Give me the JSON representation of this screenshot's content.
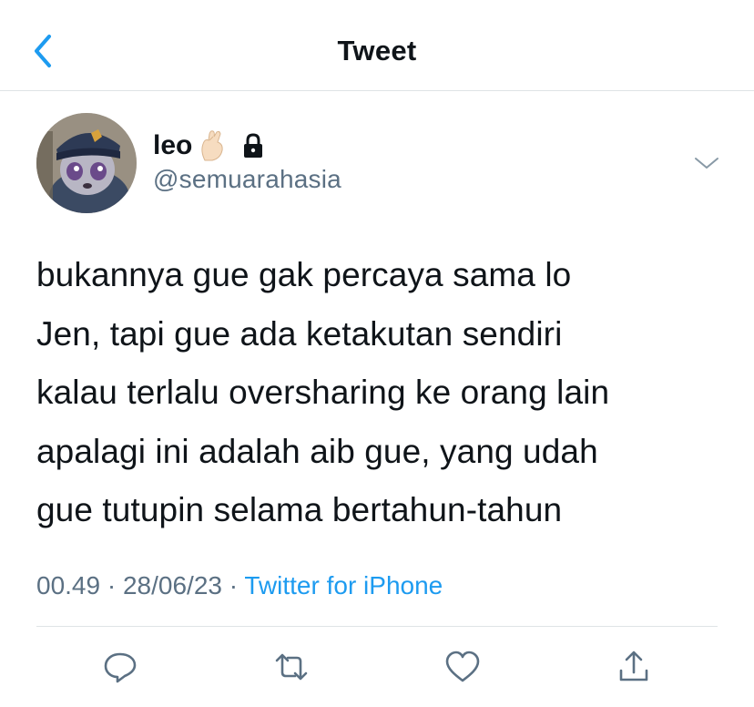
{
  "header": {
    "title": "Tweet",
    "back_icon": "chevron-left-icon"
  },
  "author": {
    "display_name": "leo",
    "handle": "@semuarahasia",
    "badges": [
      "pinched-fingers-icon",
      "lock-icon"
    ]
  },
  "tweet": {
    "lines": [
      "bukannya gue gak percaya sama lo",
      "Jen, tapi gue ada ketakutan sendiri",
      "kalau terlalu oversharing ke orang lain",
      "apalagi ini adalah aib gue, yang udah",
      "gue tutupin selama bertahun-tahun"
    ]
  },
  "meta": {
    "time": "00.49",
    "separator": " · ",
    "date": "28/06/23",
    "source": "Twitter for iPhone"
  },
  "actions": [
    "reply-icon",
    "retweet-icon",
    "like-icon",
    "share-icon"
  ],
  "colors": {
    "accent": "#1d9bf0",
    "secondary_text": "#5b7083",
    "divider": "#dfe3e6"
  }
}
